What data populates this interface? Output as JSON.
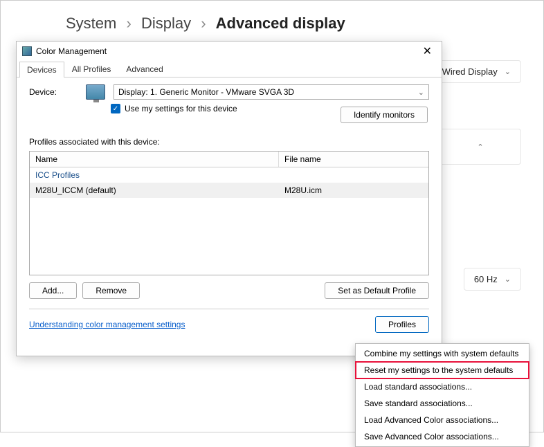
{
  "breadcrumb": {
    "a": "System",
    "b": "Display",
    "c": "Advanced display"
  },
  "background": {
    "display_selector": "Wired Display",
    "refresh": "60 Hz"
  },
  "dialog": {
    "title": "Color Management",
    "tabs": [
      "Devices",
      "All Profiles",
      "Advanced"
    ],
    "device_label": "Device:",
    "device_value": "Display: 1. Generic Monitor - VMware SVGA 3D",
    "use_settings": "Use my settings for this device",
    "identify": "Identify monitors",
    "assoc_label": "Profiles associated with this device:",
    "col_name": "Name",
    "col_file": "File name",
    "group": "ICC Profiles",
    "row_name": "M28U_ICCM (default)",
    "row_file": "M28U.icm",
    "add": "Add...",
    "remove": "Remove",
    "set_default": "Set as Default Profile",
    "link": "Understanding color management settings",
    "profiles_btn": "Profiles"
  },
  "popup": {
    "items": [
      "Combine my settings with system defaults",
      "Reset my settings to the system defaults",
      "Load standard associations...",
      "Save standard associations...",
      "Load Advanced Color associations...",
      "Save Advanced Color associations..."
    ],
    "highlight_index": 1
  }
}
